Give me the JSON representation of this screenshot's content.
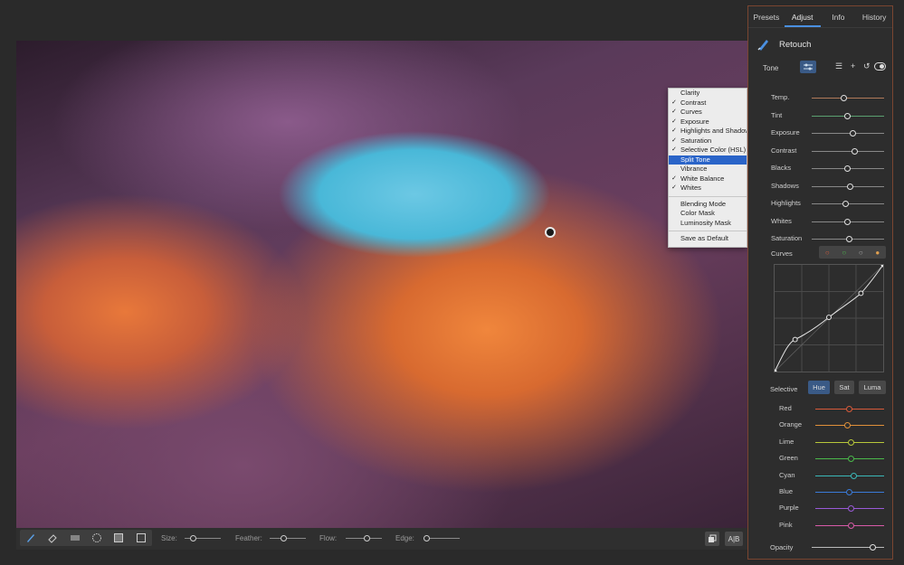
{
  "panel": {
    "tabs": [
      "Presets",
      "Adjust",
      "Info",
      "History"
    ],
    "active_tab": "Adjust",
    "title": "Retouch",
    "tone_label": "Tone",
    "tone_sliders": [
      {
        "label": "Temp.",
        "value": 0.45,
        "color": "#b07a5a"
      },
      {
        "label": "Tint",
        "value": 0.5,
        "color": "#5aa070"
      },
      {
        "label": "Exposure",
        "value": 0.57,
        "color": "#888888"
      },
      {
        "label": "Contrast",
        "value": 0.6,
        "color": "#888888"
      },
      {
        "label": "Blacks",
        "value": 0.5,
        "color": "#888888"
      },
      {
        "label": "Shadows",
        "value": 0.54,
        "color": "#888888"
      },
      {
        "label": "Highlights",
        "value": 0.47,
        "color": "#888888"
      },
      {
        "label": "Whites",
        "value": 0.5,
        "color": "#888888"
      },
      {
        "label": "Saturation",
        "value": 0.52,
        "color": "#888888"
      }
    ],
    "curves_label": "Curves",
    "selective_label": "Selective",
    "selective_buttons": [
      "Hue",
      "Sat",
      "Luma"
    ],
    "selective_active": "Hue",
    "color_sliders": [
      {
        "label": "Red",
        "value": 0.5,
        "color": "#d85a3a"
      },
      {
        "label": "Orange",
        "value": 0.47,
        "color": "#e0903a"
      },
      {
        "label": "Lime",
        "value": 0.52,
        "color": "#b8c83a"
      },
      {
        "label": "Green",
        "value": 0.52,
        "color": "#4ab84a"
      },
      {
        "label": "Cyan",
        "value": 0.57,
        "color": "#3ab8b8"
      },
      {
        "label": "Blue",
        "value": 0.5,
        "color": "#3a7ad8"
      },
      {
        "label": "Purple",
        "value": 0.52,
        "color": "#9a5ad8"
      },
      {
        "label": "Pink",
        "value": 0.52,
        "color": "#d85aa8"
      }
    ],
    "opacity_label": "Opacity",
    "opacity_value": 0.85
  },
  "menu": {
    "items": [
      {
        "label": "Clarity",
        "checked": false,
        "selected": false
      },
      {
        "label": "Contrast",
        "checked": true,
        "selected": false
      },
      {
        "label": "Curves",
        "checked": true,
        "selected": false
      },
      {
        "label": "Exposure",
        "checked": true,
        "selected": false
      },
      {
        "label": "Highlights and Shadows",
        "checked": true,
        "selected": false
      },
      {
        "label": "Saturation",
        "checked": true,
        "selected": false
      },
      {
        "label": "Selective Color (HSL)",
        "checked": true,
        "selected": false
      },
      {
        "label": "Split Tone",
        "checked": false,
        "selected": true
      },
      {
        "label": "Vibrance",
        "checked": false,
        "selected": false
      },
      {
        "label": "White Balance",
        "checked": true,
        "selected": false
      },
      {
        "label": "Whites",
        "checked": true,
        "selected": false
      }
    ],
    "extra": [
      "Blending Mode",
      "Color Mask",
      "Luminosity Mask"
    ],
    "footer": "Save as Default"
  },
  "bottombar": {
    "size_label": "Size:",
    "feather_label": "Feather:",
    "flow_label": "Flow:",
    "edge_label": "Edge:",
    "size_value": 0.25,
    "feather_value": 0.4,
    "flow_value": 0.6,
    "edge_value": 0.1,
    "ab_label": "A|B"
  }
}
